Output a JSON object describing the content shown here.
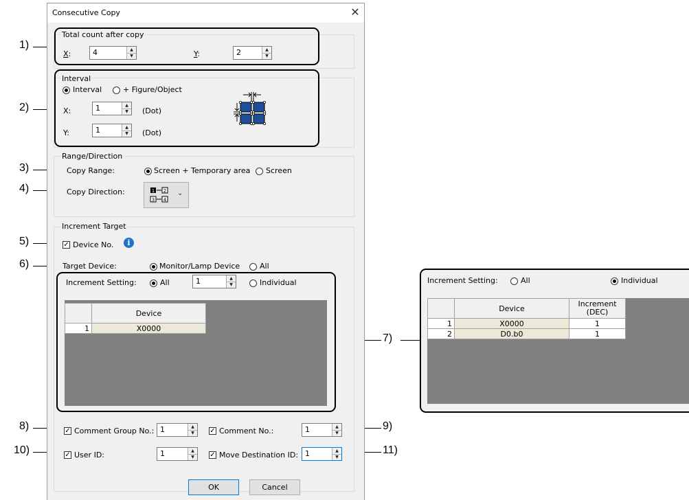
{
  "dialog": {
    "title": "Consecutive Copy",
    "close_glyph": "✕",
    "total_count": {
      "group_label": "Total count after copy",
      "x_label": "X:",
      "x_value": "4",
      "y_label": "Y:",
      "y_value": "2"
    },
    "interval": {
      "group_label": "Interval",
      "option_interval": "Interval",
      "option_figure": "+ Figure/Object",
      "selected": "Interval",
      "x_label": "X:",
      "x_value": "1",
      "x_unit": "(Dot)",
      "y_label": "Y:",
      "y_value": "1",
      "y_unit": "(Dot)",
      "diagram_icon": "interval-diagram-icon"
    },
    "range_direction": {
      "group_label": "Range/Direction",
      "copy_range_label": "Copy Range:",
      "option_screen_temp": "Screen + Temporary area",
      "option_screen": "Screen",
      "selected": "Screen + Temporary area",
      "copy_direction_label": "Copy Direction:",
      "direction_icon": "copy-direction-icon"
    },
    "increment_target": {
      "group_label": "Increment Target",
      "device_no_label": "Device No.",
      "device_no_checked": true,
      "info_icon": "info-icon",
      "target_device_label": "Target Device:",
      "option_monitor": "Monitor/Lamp Device",
      "option_all": "All",
      "target_selected": "Monitor/Lamp Device",
      "increment_setting_label": "Increment Setting:",
      "inc_option_all": "All",
      "inc_value": "1",
      "inc_option_individual": "Individual",
      "inc_selected": "All",
      "table": {
        "header": "Device",
        "rows": [
          {
            "num": "1",
            "device": "X0000"
          }
        ]
      }
    },
    "bottom": {
      "comment_group_label": "Comment Group No.:",
      "comment_group_value": "1",
      "comment_no_label": "Comment No.:",
      "comment_no_value": "1",
      "user_id_label": "User ID:",
      "user_id_value": "1",
      "move_dest_label": "Move Destination ID:",
      "move_dest_value": "1"
    },
    "ok_label": "OK",
    "cancel_label": "Cancel"
  },
  "individual_panel": {
    "increment_setting_label": "Increment Setting:",
    "option_all": "All",
    "option_individual": "Individual",
    "selected": "Individual",
    "table": {
      "headers": [
        "Device",
        "Increment\n(DEC)"
      ],
      "header_device": "Device",
      "header_increment_1": "Increment",
      "header_increment_2": "(DEC)",
      "rows": [
        {
          "num": "1",
          "device": "X0000",
          "increment": "1"
        },
        {
          "num": "2",
          "device": "D0.b0",
          "increment": "1"
        }
      ]
    }
  },
  "callouts": [
    "1)",
    "2)",
    "3)",
    "4)",
    "5)",
    "6)",
    "7)",
    "8)",
    "9)",
    "10)",
    "11)"
  ]
}
